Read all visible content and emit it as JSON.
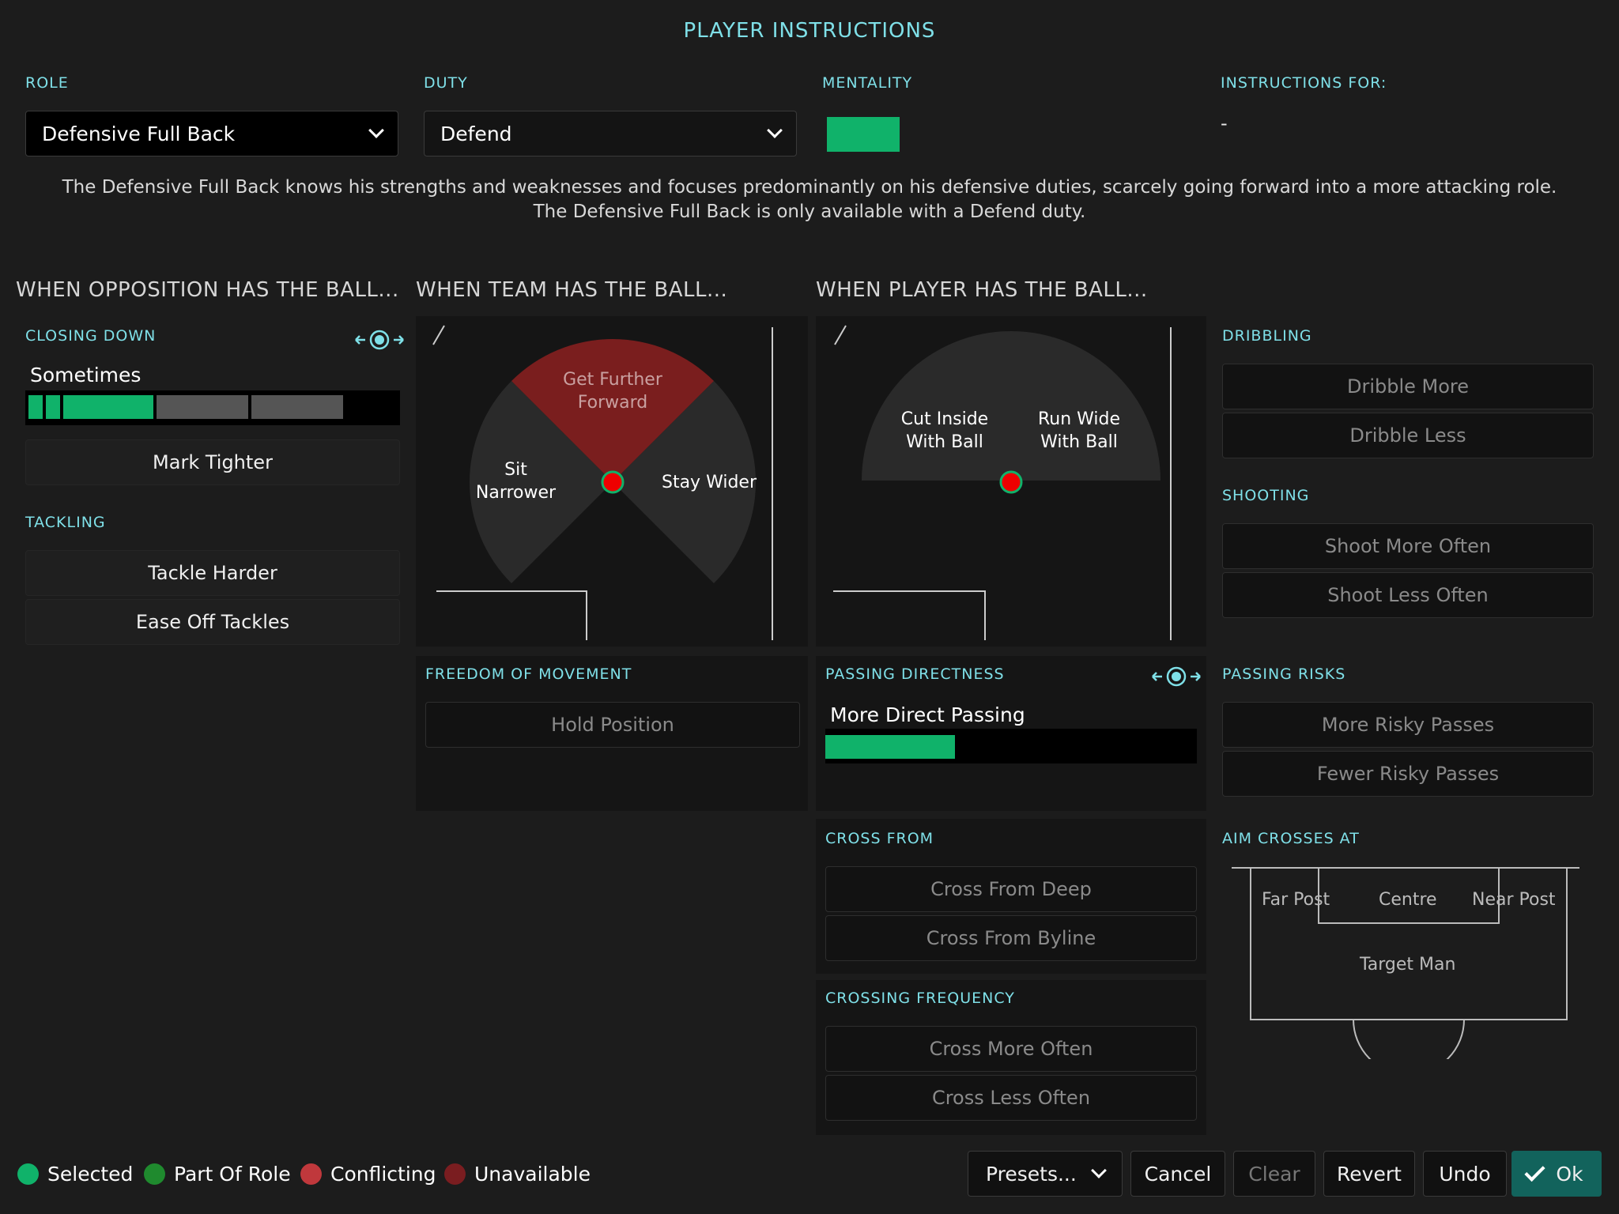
{
  "title": "PLAYER INSTRUCTIONS",
  "role": {
    "label": "ROLE",
    "value": "Defensive Full Back"
  },
  "duty": {
    "label": "DUTY",
    "value": "Defend"
  },
  "mentality": {
    "label": "MENTALITY",
    "color": "#10b26a"
  },
  "instructions_for": {
    "label": "INSTRUCTIONS FOR:",
    "value": "-"
  },
  "description": "The Defensive Full Back knows his strengths and weaknesses and focuses predominantly on his defensive duties, scarcely going forward into a more attacking role. The Defensive Full Back is only available with a Defend duty.",
  "sections": {
    "opposition": "WHEN OPPOSITION HAS THE BALL...",
    "team": "WHEN TEAM HAS THE BALL...",
    "player": "WHEN PLAYER HAS THE BALL..."
  },
  "closing_down": {
    "label": "CLOSING DOWN",
    "value": "Sometimes",
    "level": 3,
    "steps": 5,
    "mark_tighter": "Mark Tighter"
  },
  "tackling": {
    "label": "TACKLING",
    "harder": "Tackle Harder",
    "ease_off": "Ease Off Tackles"
  },
  "team_wedge": {
    "top": [
      "Get Further",
      "Forward"
    ],
    "left": [
      "Sit",
      "Narrower"
    ],
    "right": "Stay Wider"
  },
  "player_wedge": {
    "left": [
      "Cut Inside",
      "With Ball"
    ],
    "right": [
      "Run Wide",
      "With Ball"
    ]
  },
  "freedom": {
    "label": "FREEDOM OF MOVEMENT",
    "hold": "Hold Position"
  },
  "passing_directness": {
    "label": "PASSING DIRECTNESS",
    "value": "More Direct Passing",
    "fill_fraction": 0.35
  },
  "cross_from": {
    "label": "CROSS FROM",
    "deep": "Cross From Deep",
    "byline": "Cross From Byline"
  },
  "crossing_frequency": {
    "label": "CROSSING FREQUENCY",
    "more": "Cross More Often",
    "less": "Cross Less Often"
  },
  "dribbling": {
    "label": "DRIBBLING",
    "more": "Dribble More",
    "less": "Dribble Less"
  },
  "shooting": {
    "label": "SHOOTING",
    "more": "Shoot More Often",
    "less": "Shoot Less Often"
  },
  "passing_risks": {
    "label": "PASSING RISKS",
    "more": "More Risky Passes",
    "fewer": "Fewer Risky Passes"
  },
  "aim_crosses": {
    "label": "AIM CROSSES AT",
    "far": "Far Post",
    "centre": "Centre",
    "near": "Near Post",
    "target": "Target Man"
  },
  "legend": {
    "selected": "Selected",
    "part_of_role": "Part Of Role",
    "conflicting": "Conflicting",
    "unavailable": "Unavailable",
    "colors": {
      "selected": "#10b26a",
      "part_of_role": "#1f8a2e",
      "conflicting": "#c0383c",
      "unavailable": "#7a1d20"
    }
  },
  "footer": {
    "presets": "Presets...",
    "cancel": "Cancel",
    "clear": "Clear",
    "revert": "Revert",
    "undo": "Undo",
    "ok": "Ok"
  },
  "colors": {
    "accent": "#7fe0e8",
    "green": "#10b26a",
    "unavailable_wedge": "#7a1e1e",
    "ok_button": "#12635c"
  }
}
